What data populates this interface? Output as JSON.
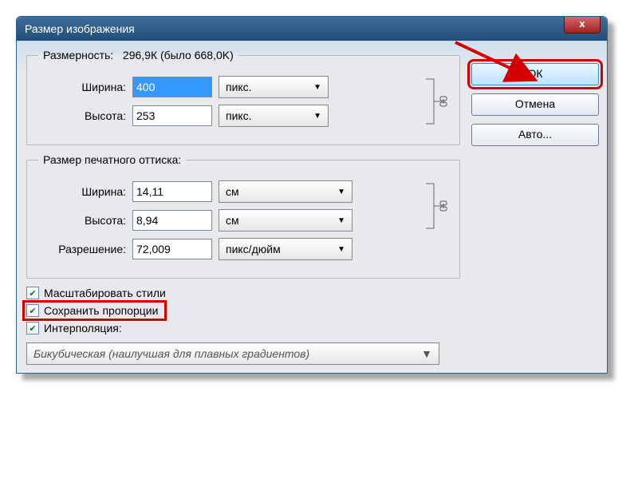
{
  "title": "Размер изображения",
  "dimensions": {
    "legend": "Размерность:",
    "summary": "296,9К (было 668,0K)",
    "width_label": "Ширина:",
    "width_value": "400",
    "width_unit": "пикс.",
    "height_label": "Высота:",
    "height_value": "253",
    "height_unit": "пикс."
  },
  "print": {
    "legend": "Размер печатного оттиска:",
    "width_label": "Ширина:",
    "width_value": "14,11",
    "width_unit": "см",
    "height_label": "Высота:",
    "height_value": "8,94",
    "height_unit": "см",
    "res_label": "Разрешение:",
    "res_value": "72,009",
    "res_unit": "пикс/дюйм"
  },
  "checks": {
    "scale_styles": "Масштабировать стили",
    "constrain": "Сохранить пропорции",
    "interp": "Интерполяция:"
  },
  "interp_value": "Бикубическая (наилучшая для плавных градиентов)",
  "buttons": {
    "ok": "ОК",
    "cancel": "Отмена",
    "auto": "Авто..."
  },
  "close_glyph": "x"
}
